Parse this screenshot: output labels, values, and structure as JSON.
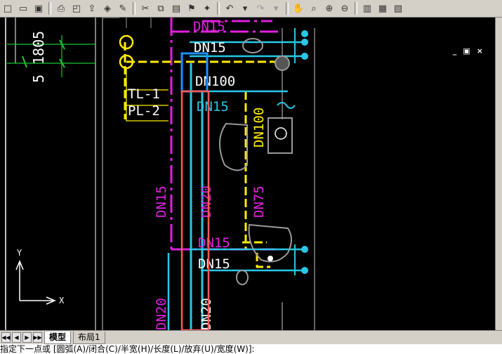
{
  "toolbar": {
    "buttons": [
      "new",
      "open",
      "save",
      "print",
      "print-preview",
      "publish",
      "3d-dwf",
      "markup",
      "cut",
      "copy",
      "paste",
      "match-properties",
      "block-editor",
      "undo",
      "redo",
      "pan",
      "zoom-realtime",
      "zoom-window",
      "zoom-previous",
      "properties",
      "design-center",
      "tool-palettes"
    ]
  },
  "drawing": {
    "labels": {
      "dn15_top": "DN15",
      "dn15_a": "DN15",
      "dn100_h": "DN100",
      "tl1": "TL-1",
      "pl2": "PL-2",
      "dn15_b": "DN15",
      "dn100_v": "DN100",
      "dn15_left": "DN15",
      "dn20_mid": "DN20",
      "dn75": "DN75",
      "dn15_c": "DN15",
      "dn15_d": "DN15",
      "dn20_left": "DN20",
      "dn20_bottom": "DN20",
      "dim_top": "1805",
      "dim_num": "5"
    },
    "ucs": {
      "y": "Y",
      "x": "X"
    }
  },
  "window_controls": {
    "minimize": "_",
    "restore": "▣",
    "close": "×"
  },
  "tabs": {
    "model": "模型",
    "layout1": "布局1"
  },
  "nav": {
    "first": "◀◀",
    "prev": "◀",
    "next": "▶",
    "last": "▶▶"
  },
  "command": {
    "prompt": "指定下一点或 [圆弧(A)/闭合(C)/半宽(H)/长度(L)/放弃(U)/宽度(W)]:"
  },
  "colors": {
    "background": "#000000",
    "cyan_pipe": "#29c8e8",
    "magenta_pipe": "#e020e0",
    "yellow_pipe": "#ffeb00",
    "highlight_blue": "#1e90ff",
    "highlight_red": "#ff5a5a",
    "green_dim": "#18c830"
  }
}
